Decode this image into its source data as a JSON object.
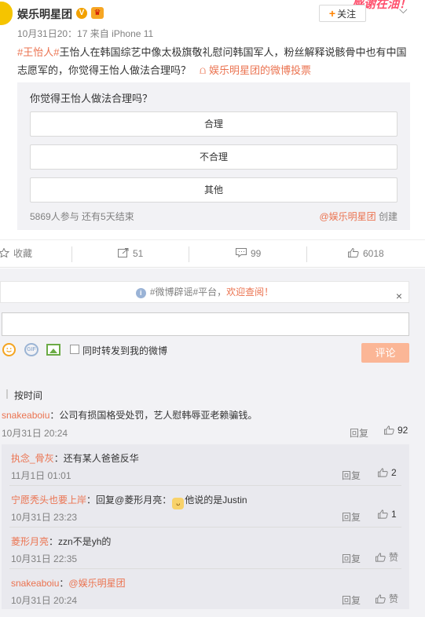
{
  "post": {
    "author": "娱乐明星团",
    "badge_v": "V",
    "time": "10月31日20：17 来自",
    "device": "iPhone 11",
    "follow_label": "关注",
    "follow_plus": "+",
    "deco_text": "感谢在油！",
    "topic": "#王怡人#",
    "text": "王怡人在韩国综艺中像太极旗敬礼慰问韩国军人，粉丝解释说骸骨中也有中国志愿军的，你觉得王怡人做法合理吗？",
    "vote_link_icon": "⩍",
    "vote_link": "娱乐明星团的微博投票"
  },
  "poll": {
    "question": "你觉得王怡人做法合理吗？",
    "options": [
      "合理",
      "不合理",
      "其他"
    ],
    "stats": "5869人参与 还有5天结束",
    "creator": "@娱乐明星团",
    "creator_suffix": " 创建"
  },
  "actions": {
    "favorite": "收藏",
    "repost": "51",
    "comment": "99",
    "like": "6018"
  },
  "comment_box": {
    "notice_prefix": "#微博辟谣#平台，",
    "notice_link": "欢迎查阅！",
    "close": "×",
    "gif_label": "GIF",
    "also_repost": "同时转发到我的微博",
    "submit": "评论"
  },
  "sort_label": "按时间",
  "comments": [
    {
      "user": "snakeaboiu",
      "text": "：公司有损国格受处罚，艺人慰韩辱亚老赖骗钱。",
      "time": "10月31日 20:24",
      "reply": "回复",
      "likes": "92"
    }
  ],
  "replies": [
    {
      "user": "执念_骨灰",
      "text": "：还有某人爸爸反华",
      "time": "11月1日 01:01",
      "reply": "回复",
      "likes": "2"
    },
    {
      "user": "宁愿秃头也要上岸",
      "text_a": "：回复@",
      "mention": "菱形月亮",
      "text_b": "：",
      "text_c": "他说的是Justin",
      "time": "10月31日 23:23",
      "reply": "回复",
      "likes": "1"
    },
    {
      "user": "菱形月亮",
      "text": "：zzn不是yh的",
      "time": "10月31日 22:35",
      "reply": "回复",
      "likes": "赞"
    },
    {
      "user": "snakeaboiu",
      "text": "：",
      "mention": "@娱乐明星团",
      "time": "10月31日 20:24",
      "reply": "回复",
      "likes": "赞"
    }
  ],
  "colors": {
    "accent": "#eb7350",
    "brand": "#ff8200",
    "panel": "#f2f2f5"
  }
}
